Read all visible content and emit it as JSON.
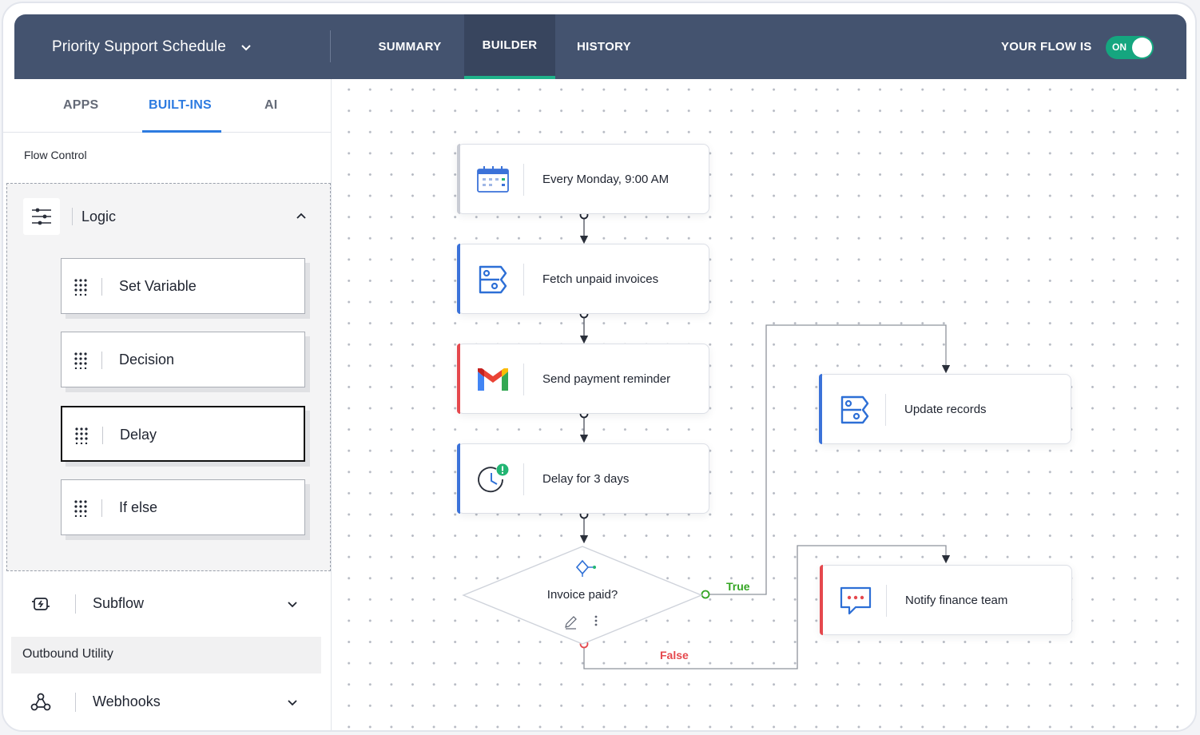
{
  "header": {
    "flow_name": "Priority Support Schedule",
    "tabs": [
      "SUMMARY",
      "BUILDER",
      "HISTORY"
    ],
    "active_tab": "BUILDER",
    "status_label": "YOUR FLOW IS",
    "toggle_label": "ON",
    "toggle_on": true
  },
  "sidebar": {
    "tabs": [
      "APPS",
      "BUILT-INS",
      "AI"
    ],
    "active_tab": "BUILT-INS",
    "flow_control_label": "Flow Control",
    "logic": {
      "label": "Logic",
      "expanded": true,
      "blocks": [
        "Set Variable",
        "Decision",
        "Delay",
        "If else"
      ],
      "active_block": "Delay"
    },
    "subflow_label": "Subflow",
    "outbound_label": "Outbound Utility",
    "webhooks_label": "Webhooks"
  },
  "canvas": {
    "nodes": [
      {
        "label": "Every Monday, 9:00 AM",
        "icon": "calendar-icon"
      },
      {
        "label": "Fetch unpaid invoices",
        "icon": "records-icon"
      },
      {
        "label": "Send payment reminder",
        "icon": "gmail-icon"
      },
      {
        "label": "Delay for 3 days",
        "icon": "clock-alert-icon"
      },
      {
        "label": "Update records",
        "icon": "records-icon"
      },
      {
        "label": "Notify finance team",
        "icon": "chat-icon"
      }
    ],
    "decision": {
      "label": "Invoice paid?",
      "true_label": "True",
      "false_label": "False"
    }
  },
  "colors": {
    "header_bg": "#44536f",
    "active_tab_underline": "#1fb28a",
    "toggle_on": "#15a67f",
    "sidebar_active": "#2d7be0",
    "accent_blue": "#3b72d9",
    "accent_red": "#e5484d",
    "true_green": "#34a523"
  }
}
